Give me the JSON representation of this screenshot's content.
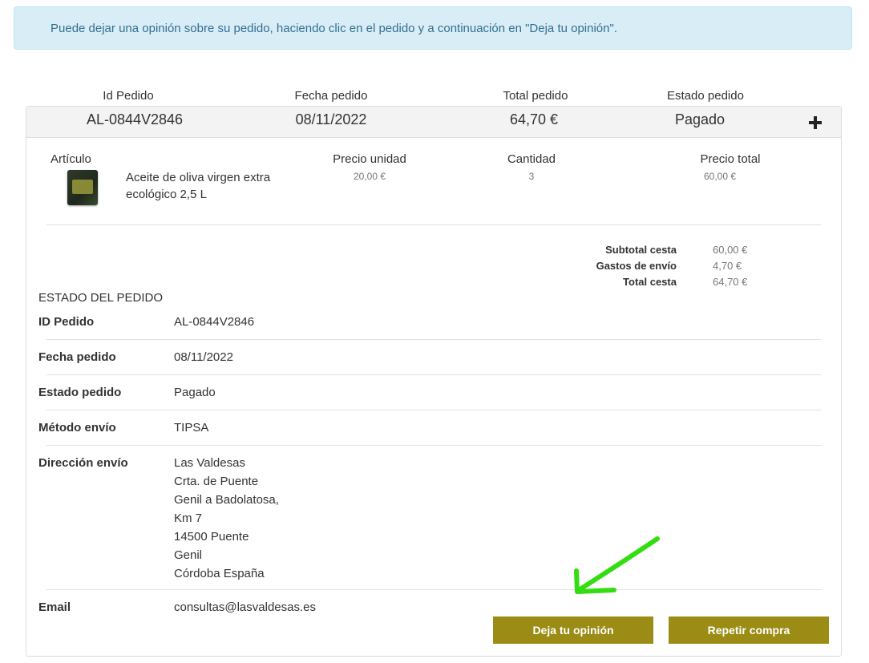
{
  "alert": {
    "text": "Puede dejar una opinión sobre su pedido, haciendo clic en el pedido y a continuación en \"Deja tu opinión\"."
  },
  "order_header": {
    "columns": [
      "Id Pedido",
      "Fecha pedido",
      "Total pedido",
      "Estado pedido"
    ],
    "values": [
      "AL-0844V2846",
      "08/11/2022",
      "64,70 €",
      "Pagado"
    ],
    "expand_icon": "plus-icon"
  },
  "items_table": {
    "headers": [
      "Artículo",
      "Precio unidad",
      "Cantidad",
      "Precio total"
    ],
    "rows": [
      {
        "name": "Aceite de oliva virgen extra ecológico 2,5 L",
        "unit_price": "20,00 €",
        "quantity": "3",
        "total": "60,00 €"
      }
    ]
  },
  "totals": [
    {
      "label": "Subtotal cesta",
      "value": "60,00 €"
    },
    {
      "label": "Gastos de envío",
      "value": "4,70 €"
    },
    {
      "label": "Total cesta",
      "value": "64,70 €"
    }
  ],
  "status": {
    "title": "ESTADO DEL PEDIDO",
    "rows": [
      {
        "label": "ID Pedido",
        "value": "AL-0844V2846"
      },
      {
        "label": "Fecha pedido",
        "value": "08/11/2022"
      },
      {
        "label": "Estado pedido",
        "value": "Pagado"
      },
      {
        "label": "Método envío",
        "value": "TIPSA"
      },
      {
        "label": "Dirección envío",
        "lines": [
          "Las Valdesas",
          "Crta. de Puente",
          "Genil a Badolatosa,",
          "Km 7",
          "14500 Puente",
          "Genil",
          "Córdoba España"
        ]
      },
      {
        "label": "Email",
        "value": "consultas@lasvaldesas.es"
      }
    ]
  },
  "buttons": {
    "review": "Deja tu opinión",
    "repeat": "Repetir compra"
  },
  "colors": {
    "alert_bg": "#d9edf7",
    "alert_text": "#31708f",
    "button": "#9a8c14",
    "arrow": "#33dd11"
  }
}
